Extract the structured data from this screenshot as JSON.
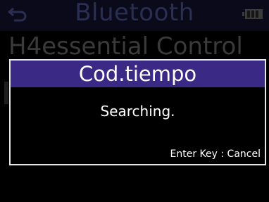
{
  "background_screen": {
    "title": "Bluetooth",
    "item": "H4essential Control",
    "back_icon": "back-arrow-icon",
    "battery_icon": "battery-icon"
  },
  "dialog": {
    "title": "Cod.tiempo",
    "message": "Searching.",
    "hint": "Enter Key : Cancel"
  },
  "colors": {
    "dialog_header": "#3b2a85",
    "dimmed_header_text": "#2a2f52",
    "dimmed_item_text": "#3a3a3a",
    "dialog_border": "#e6e6e6"
  }
}
